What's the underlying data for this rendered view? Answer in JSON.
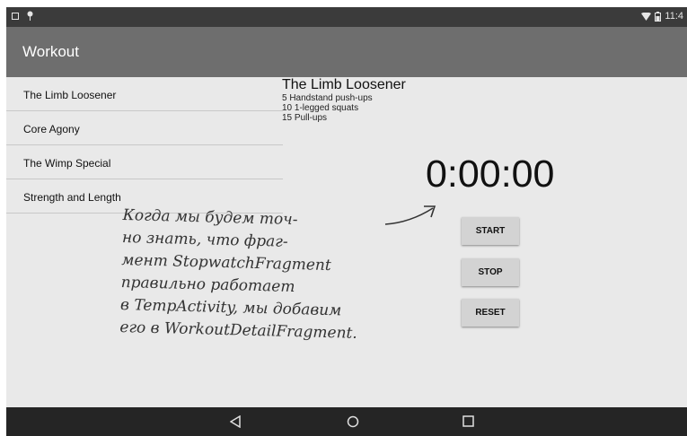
{
  "status_bar": {
    "time": "11:4",
    "icons": [
      "screenshot-icon",
      "pin-icon",
      "wifi-icon",
      "battery-icon"
    ]
  },
  "action_bar": {
    "title": "Workout"
  },
  "workout_list": [
    {
      "label": "The Limb Loosener"
    },
    {
      "label": "Core Agony"
    },
    {
      "label": "The Wimp Special"
    },
    {
      "label": "Strength and Length"
    }
  ],
  "detail": {
    "title": "The Limb Loosener",
    "lines": [
      "5 Handstand push-ups",
      "10 1-legged squats",
      "15 Pull-ups"
    ]
  },
  "stopwatch": {
    "time": "0:00:00",
    "start_label": "START",
    "stop_label": "STOP",
    "reset_label": "RESET"
  },
  "nav_bar": {
    "icons": [
      "back-icon",
      "home-icon",
      "recents-icon"
    ]
  },
  "annotation": {
    "lines": [
      "Когда мы будем точ-",
      "но знать, что фраг-",
      "мент StopwatchFragment",
      "правильно работает",
      "в TempActivity, мы добавим",
      "его в WorkoutDetailFragment."
    ]
  },
  "colors": {
    "status_bar": "#3b3b3b",
    "action_bar": "#6e6e6e",
    "background": "#e9e9e9",
    "nav_bar": "#252525",
    "button": "#d3d3d3"
  }
}
